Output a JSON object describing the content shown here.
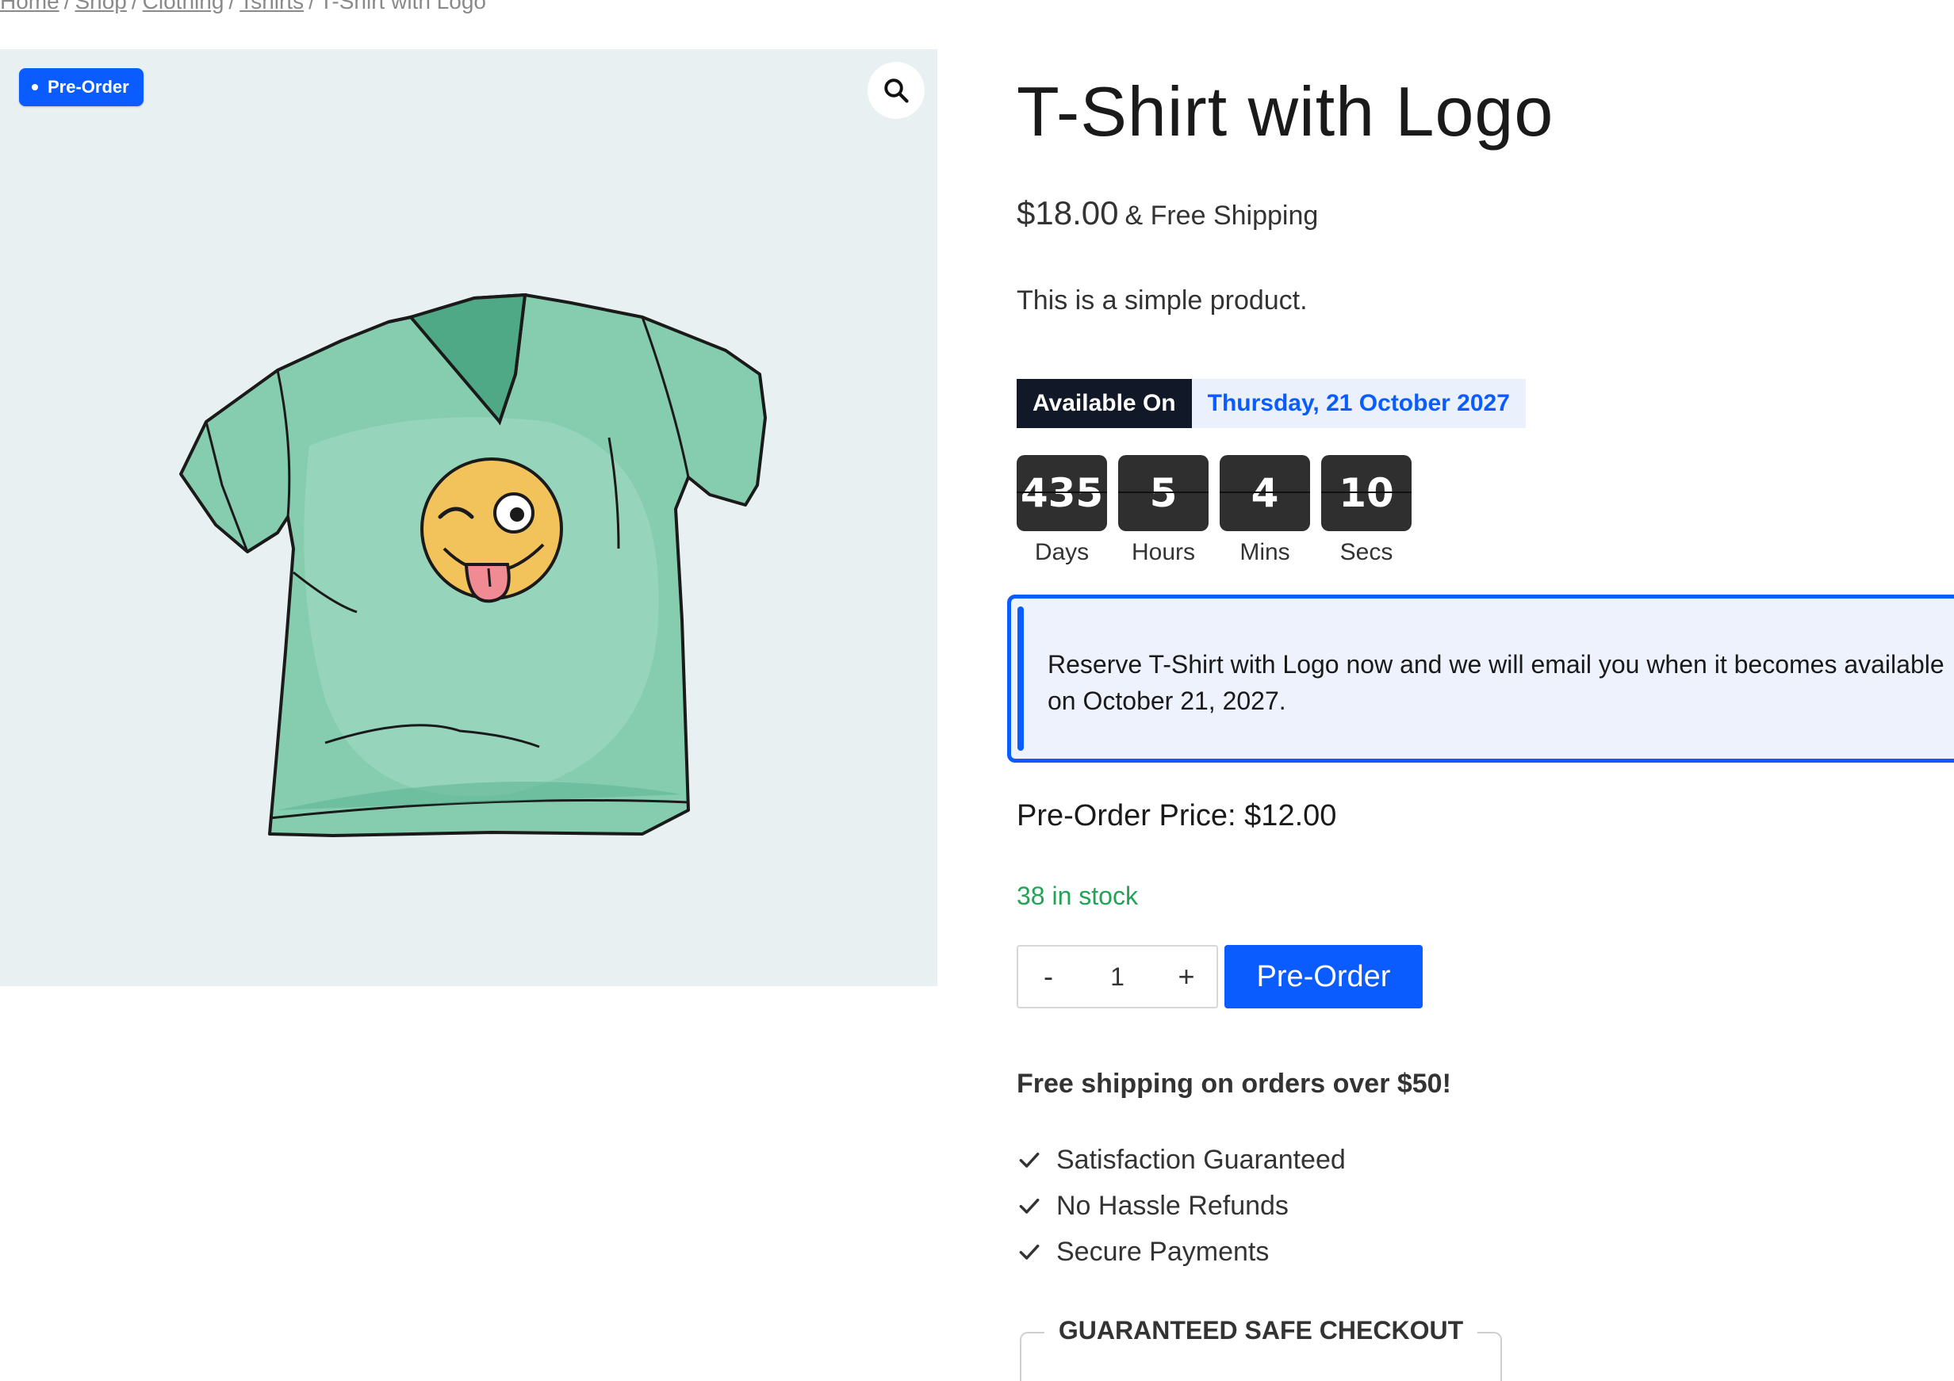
{
  "breadcrumb": {
    "items": [
      "Home",
      "Shop",
      "Clothing",
      "Tshirts"
    ],
    "current": "T-Shirt with Logo",
    "separator": "/"
  },
  "gallery": {
    "badge": "Pre-Order",
    "zoom_icon": "search-icon",
    "image": "t-shirt with winking emoji illustration",
    "background": "#e8f0f1"
  },
  "product": {
    "title": "T-Shirt with Logo",
    "price": "$18.00",
    "shipping_suffix": "& Free Shipping",
    "short_description": "This is a simple product."
  },
  "availability": {
    "label": "Available On",
    "date": "Thursday, 21 October 2027"
  },
  "countdown": [
    {
      "value": "435",
      "label": "Days"
    },
    {
      "value": "5",
      "label": "Hours"
    },
    {
      "value": "4",
      "label": "Mins"
    },
    {
      "value": "10",
      "label": "Secs"
    }
  ],
  "notice": {
    "text": "Reserve T-Shirt with Logo now and we will email you when it becomes available on October 21, 2027."
  },
  "preorder_price": "Pre-Order Price: $12.00",
  "stock": "38 in stock",
  "quantity": {
    "decrement": "-",
    "value": "1",
    "increment": "+"
  },
  "preorder_button": "Pre-Order",
  "shipping_offer": "Free shipping on orders over $50!",
  "benefits": [
    "Satisfaction Guaranteed",
    "No Hassle Refunds",
    "Secure Payments"
  ],
  "safe_checkout": "GUARANTEED SAFE CHECKOUT",
  "colors": {
    "accent": "#0b5cff",
    "dark": "#111827",
    "stock_green": "#22a356",
    "notice_bg": "#edf2fc"
  }
}
